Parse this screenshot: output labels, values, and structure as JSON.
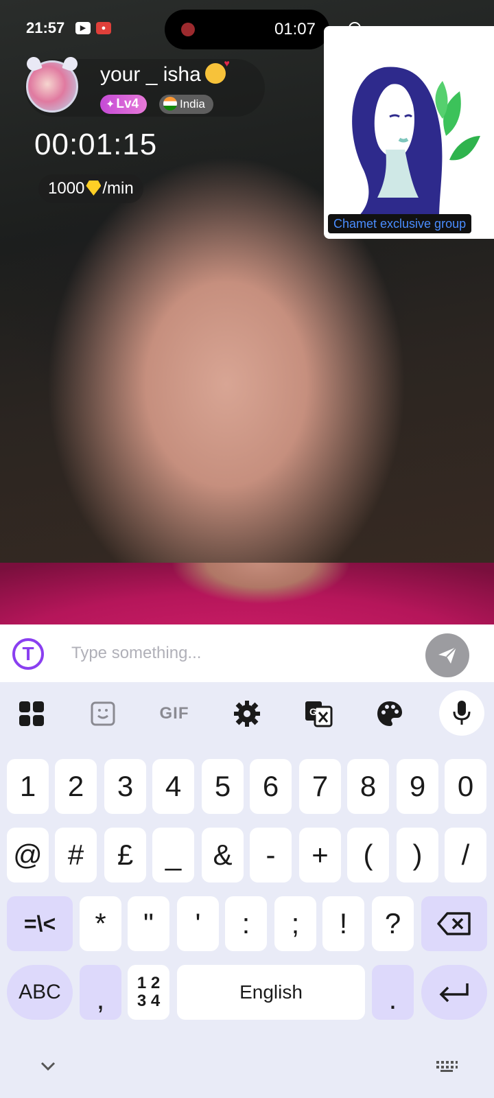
{
  "status_bar": {
    "time": "21:57"
  },
  "recording": {
    "elapsed": "01:07"
  },
  "profile": {
    "username": "your _ isha",
    "level": "Lv4",
    "country": "India"
  },
  "call": {
    "timer": "00:01:15",
    "rate_amount": "1000",
    "rate_unit": "/min"
  },
  "group_card": {
    "label": "Chamet exclusive group"
  },
  "chat": {
    "placeholder": "Type something..."
  },
  "keyboard": {
    "toolbar": {
      "gif": "GIF"
    },
    "row1": [
      "1",
      "2",
      "3",
      "4",
      "5",
      "6",
      "7",
      "8",
      "9",
      "0"
    ],
    "row2": [
      "@",
      "#",
      "£",
      "_",
      "&",
      "-",
      "+",
      "(",
      ")",
      "/"
    ],
    "row3": {
      "toggle": "=\\<",
      "keys": [
        "*",
        "\"",
        "'",
        ":",
        ";",
        "!",
        "?"
      ]
    },
    "row4": {
      "abc": "ABC",
      "comma": ",",
      "numpad_top": "1 2",
      "numpad_bottom": "3 4",
      "space": "English",
      "period": "."
    }
  }
}
